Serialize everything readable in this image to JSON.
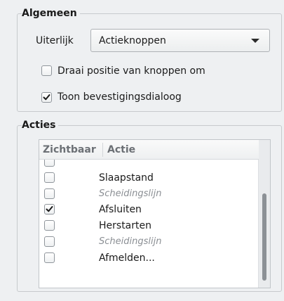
{
  "general": {
    "title": "Algemeen",
    "appearance_label": "Uiterlijk",
    "appearance_value": "Actieknoppen",
    "reverse_label": "Draai positie van knoppen om",
    "reverse_checked": false,
    "confirm_label": "Toon bevestigingsdialoog",
    "confirm_checked": true
  },
  "actions": {
    "title": "Acties",
    "columns": [
      "Zichtbaar",
      "Actie"
    ],
    "rows": [
      {
        "label": "",
        "checked": false,
        "separator": false
      },
      {
        "label": "Slaapstand",
        "checked": false,
        "separator": false
      },
      {
        "label": "Scheidingslijn",
        "checked": false,
        "separator": true
      },
      {
        "label": "Afsluiten",
        "checked": true,
        "separator": false
      },
      {
        "label": "Herstarten",
        "checked": false,
        "separator": false
      },
      {
        "label": "Scheidingslijn",
        "checked": false,
        "separator": true
      },
      {
        "label": "Afmelden...",
        "checked": false,
        "separator": false
      }
    ]
  },
  "colors": {
    "background": "#eef0f2",
    "check": "#1a1a1a",
    "separator_text": "#8b8f94"
  }
}
